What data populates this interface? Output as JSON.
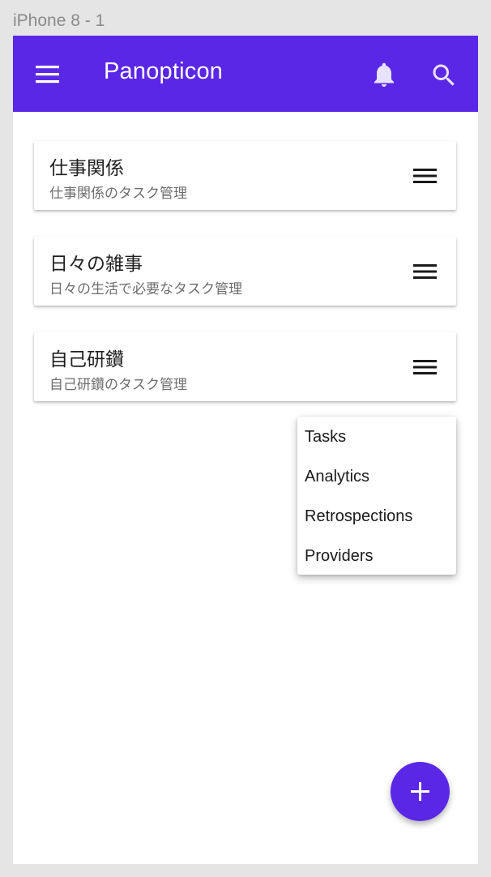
{
  "frame": {
    "label": "iPhone 8 - 1"
  },
  "appbar": {
    "title": "Panopticon",
    "icons": {
      "menu": "menu-icon",
      "notifications": "bell-icon",
      "search": "search-icon"
    },
    "color": "#5b27e6"
  },
  "cards": [
    {
      "title": "仕事関係",
      "subtitle": "仕事関係のタスク管理"
    },
    {
      "title": "日々の雑事",
      "subtitle": "日々の生活で必要なタスク管理"
    },
    {
      "title": "自己研鑽",
      "subtitle": "自己研鑽のタスク管理"
    }
  ],
  "popup_menu": {
    "items": [
      "Tasks",
      "Analytics",
      "Retrospections",
      "Providers"
    ]
  },
  "fab": {
    "icon": "plus-icon",
    "color": "#5b27e6"
  }
}
